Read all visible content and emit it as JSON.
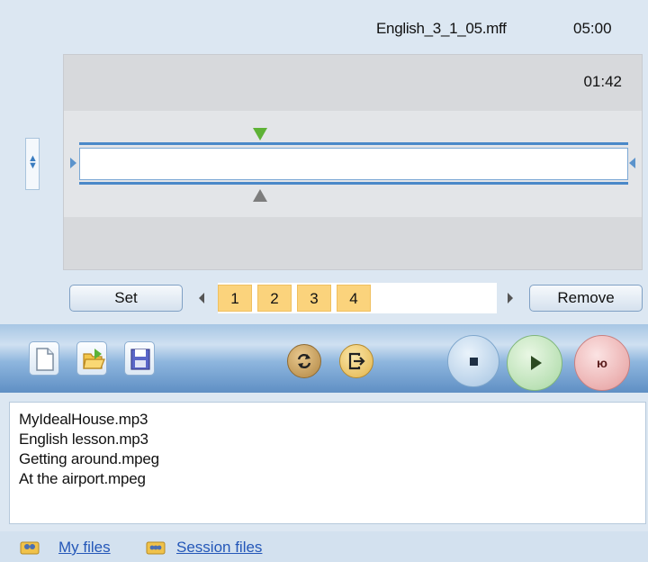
{
  "header": {
    "filename": "English_3_1_05.mff",
    "duration": "05:00"
  },
  "timeline": {
    "current_time": "01:42"
  },
  "controls": {
    "set_label": "Set",
    "remove_label": "Remove",
    "bookmarks": [
      "1",
      "2",
      "3",
      "4"
    ]
  },
  "toolbar": {
    "icons": [
      "new-file-icon",
      "open-folder-icon",
      "save-icon",
      "loop-icon",
      "exit-icon",
      "stop-icon",
      "play-icon",
      "record-icon"
    ],
    "rec_label": "ю"
  },
  "files": [
    "MyIdealHouse.mp3",
    "English lesson.mp3",
    "Getting around.mpeg",
    "At the airport.mpeg"
  ],
  "footer": {
    "my_files": "My files",
    "session_files": "Session files"
  },
  "colors": {
    "accent": "#4a88c8",
    "bookmark": "#fbd37c",
    "link": "#2457b8",
    "play": "#3a5a2a"
  }
}
